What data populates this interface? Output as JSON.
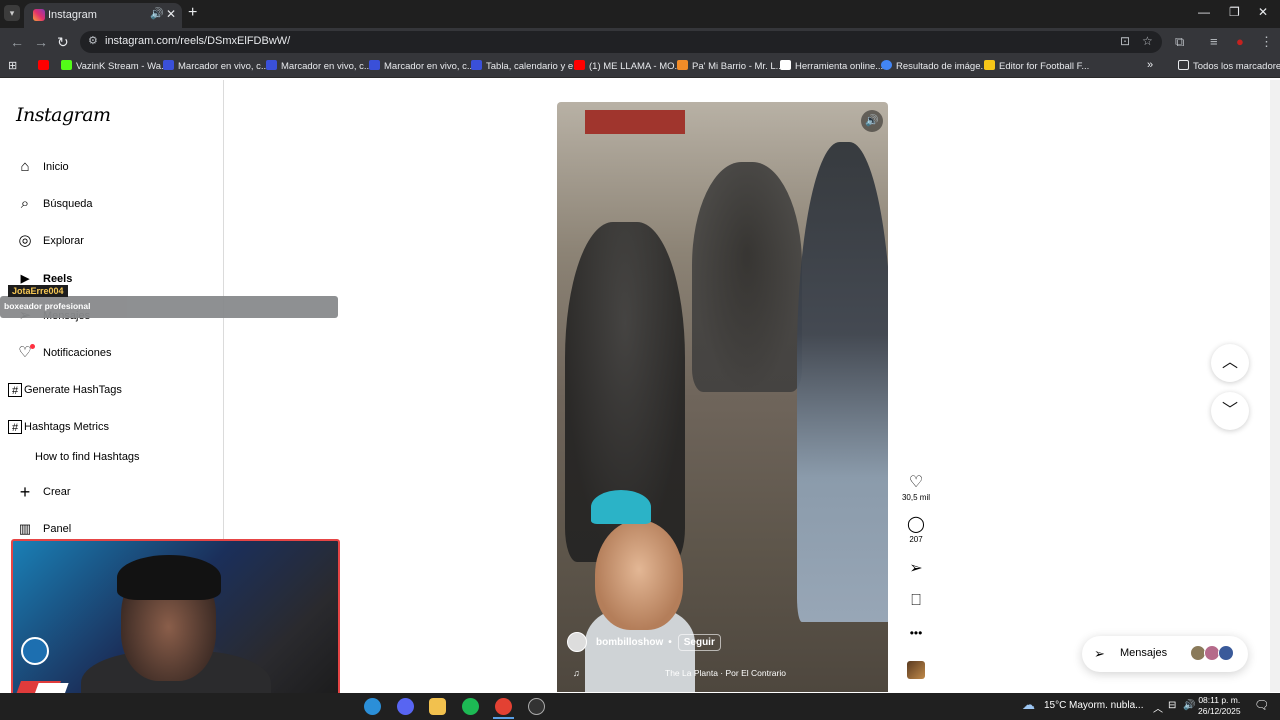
{
  "browser": {
    "tab": {
      "title": "Instagram",
      "speaker_icon": "speaker-icon",
      "close_glyph": "✕"
    },
    "new_tab_glyph": "+",
    "window_controls": [
      "—",
      "❐",
      "✕"
    ],
    "url": "instagram.com/reels/DSmxElFDBwW/",
    "bookmarks": [
      {
        "label": "",
        "color": "#ff0000"
      },
      {
        "label": "VazinK Stream - Wa...",
        "color": "#53fc18"
      },
      {
        "label": "Marcador en vivo, c...",
        "color": "#3a50d9"
      },
      {
        "label": "Marcador en vivo, c...",
        "color": "#3a50d9"
      },
      {
        "label": "Marcador en vivo, c...",
        "color": "#3a50d9"
      },
      {
        "label": "Tabla, calendario y e...",
        "color": "#3a50d9"
      },
      {
        "label": "(1) ME LLAMA - MO...",
        "color": "#ff0000"
      },
      {
        "label": "Pa' Mi Barrio - Mr. L...",
        "color": "#f28c28"
      },
      {
        "label": "Herramienta online...",
        "color": "#ffffff"
      },
      {
        "label": "Resultado de imáge...",
        "color": "#4285f4"
      },
      {
        "label": "Editor for Football F...",
        "color": "#f5c518"
      }
    ],
    "bookmarks_more": "»",
    "all_bookmarks": "Todos los marcadores"
  },
  "sidebar": {
    "logo": "Instagram",
    "items": [
      {
        "label": "Inicio",
        "icon": "⌂"
      },
      {
        "label": "Búsqueda",
        "icon": "⌕"
      },
      {
        "label": "Explorar",
        "icon": "◎"
      },
      {
        "label": "Reels",
        "icon": "▶"
      },
      {
        "label": "Mensajes",
        "icon": "➢"
      },
      {
        "label": "Notificaciones",
        "icon": "♡"
      },
      {
        "label": "Generate HashTags",
        "icon": "#"
      },
      {
        "label": "Hashtags Metrics",
        "icon": "#"
      },
      {
        "label": "How to find Hashtags",
        "icon": ""
      },
      {
        "label": "Crear",
        "icon": "+"
      },
      {
        "label": "Panel",
        "icon": "▥"
      }
    ]
  },
  "overlay": {
    "tag": "JotaErre004",
    "subtitle": "boxeador profesional"
  },
  "reel": {
    "owner": "bombilloshow",
    "separator": "•",
    "follow": "Seguir",
    "music": "The La Planta · Por El Contrario",
    "music_glyph": "♫",
    "likes": "30,5 mil",
    "comments": "207"
  },
  "messages_button": "Mensajes",
  "taskbar": {
    "weather": "15°C",
    "weather_desc": "Mayorm. nubla...",
    "time": "08:11 p. m.",
    "date": "26/12/2025"
  }
}
